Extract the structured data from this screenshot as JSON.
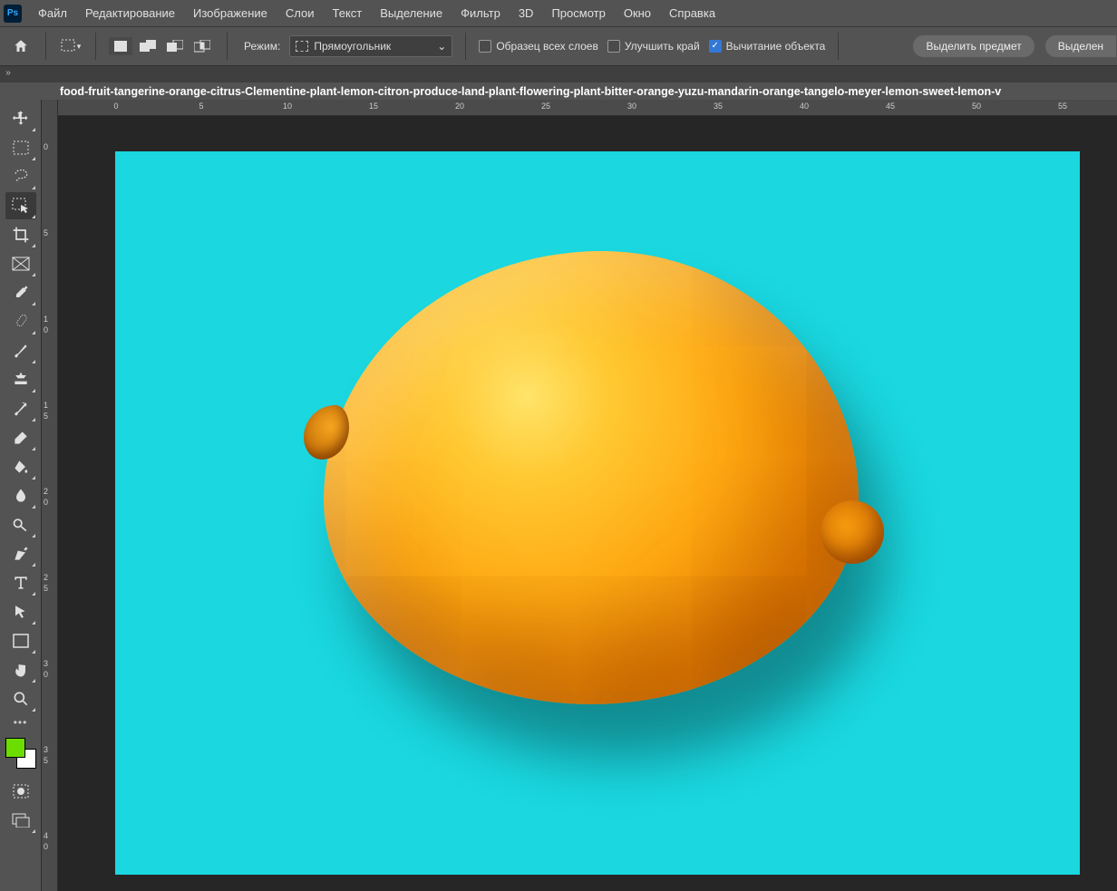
{
  "menu": [
    "Файл",
    "Редактирование",
    "Изображение",
    "Слои",
    "Текст",
    "Выделение",
    "Фильтр",
    "3D",
    "Просмотр",
    "Окно",
    "Справка"
  ],
  "app_initials": "Ps",
  "options": {
    "mode_label": "Режим:",
    "mode_value": "Прямоугольник",
    "sample_all": "Образец всех слоев",
    "enhance_edge": "Улучшить край",
    "subtract_obj": "Вычитание объекта",
    "select_subject": "Выделить предмет",
    "select_and_mask": "Выделен"
  },
  "document_name": "food-fruit-tangerine-orange-citrus-Clementine-plant-lemon-citron-produce-land-plant-flowering-plant-bitter-orange-yuzu-mandarin-orange-tangelo-meyer-lemon-sweet-lemon-v",
  "hruler": [
    {
      "v": "0",
      "p": 64
    },
    {
      "v": "5",
      "p": 158
    },
    {
      "v": "10",
      "p": 253
    },
    {
      "v": "15",
      "p": 348
    },
    {
      "v": "20",
      "p": 443
    },
    {
      "v": "25",
      "p": 538
    },
    {
      "v": "30",
      "p": 633
    },
    {
      "v": "35",
      "p": 728
    },
    {
      "v": "40",
      "p": 823
    },
    {
      "v": "45",
      "p": 918
    },
    {
      "v": "50",
      "p": 1013
    },
    {
      "v": "55",
      "p": 1108
    }
  ],
  "vruler": [
    {
      "v": "0",
      "p": 52
    },
    {
      "v": "5",
      "p": 147
    },
    {
      "v": "1",
      "p": 242
    },
    {
      "v": "0",
      "p": 254
    },
    {
      "v": "1",
      "p": 337
    },
    {
      "v": "5",
      "p": 349
    },
    {
      "v": "2",
      "p": 432
    },
    {
      "v": "0",
      "p": 444
    },
    {
      "v": "2",
      "p": 527
    },
    {
      "v": "5",
      "p": 539
    },
    {
      "v": "3",
      "p": 622
    },
    {
      "v": "0",
      "p": 634
    },
    {
      "v": "3",
      "p": 717
    },
    {
      "v": "5",
      "p": 729
    },
    {
      "v": "4",
      "p": 812
    },
    {
      "v": "0",
      "p": 824
    }
  ]
}
